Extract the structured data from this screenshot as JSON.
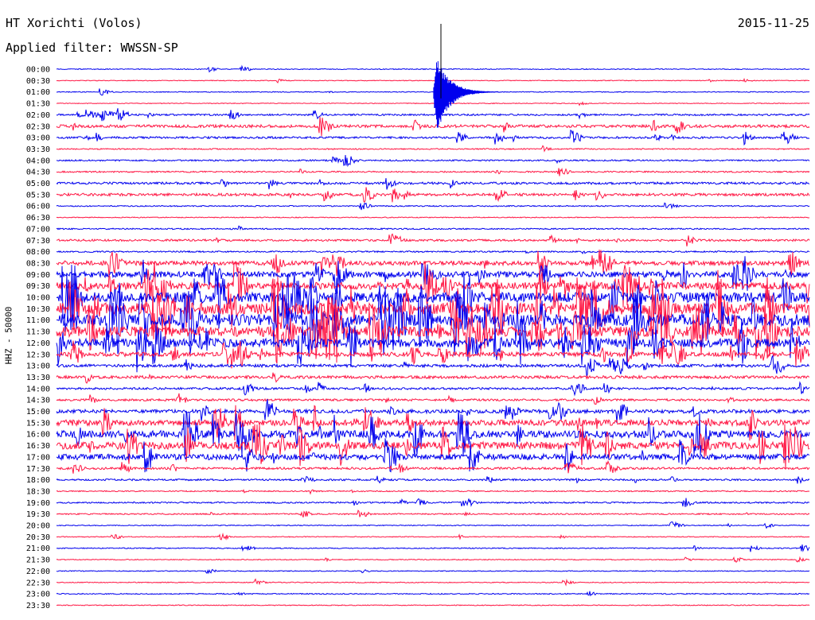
{
  "chart_data": {
    "type": "line",
    "title": "HT Xorichti (Volos)",
    "subtitle": "Applied filter: WWSSN-SP",
    "date": "2015-11-25",
    "ylabel": "HHZ - 50000",
    "row_labels": [
      "00:00",
      "00:30",
      "01:00",
      "01:30",
      "02:00",
      "02:30",
      "03:00",
      "03:30",
      "04:00",
      "04:30",
      "05:00",
      "05:30",
      "06:00",
      "06:30",
      "07:00",
      "07:30",
      "08:00",
      "08:30",
      "09:00",
      "09:30",
      "10:00",
      "10:30",
      "11:00",
      "11:30",
      "12:00",
      "12:30",
      "13:00",
      "13:30",
      "14:00",
      "14:30",
      "15:00",
      "15:30",
      "16:00",
      "16:30",
      "17:00",
      "17:30",
      "18:00",
      "18:30",
      "19:00",
      "19:30",
      "20:00",
      "20:30",
      "21:00",
      "21:30",
      "22:00",
      "22:30",
      "23:00",
      "23:30"
    ],
    "row_activity": [
      0.6,
      0.5,
      0.6,
      0.5,
      1.2,
      2.0,
      1.4,
      0.8,
      1.0,
      1.0,
      1.6,
      1.8,
      0.8,
      0.6,
      0.9,
      1.4,
      1.0,
      3.0,
      4.0,
      5.0,
      7.0,
      8.0,
      8.0,
      7.0,
      6.0,
      3.0,
      2.0,
      2.0,
      1.5,
      1.5,
      2.5,
      4.0,
      5.0,
      5.0,
      4.0,
      1.5,
      1.2,
      0.8,
      1.0,
      0.9,
      0.6,
      0.6,
      0.7,
      0.6,
      0.6,
      0.6,
      0.7,
      0.6
    ],
    "series_colors": [
      "#0000ee",
      "#ff1744"
    ],
    "events": [
      {
        "row": 2,
        "minute": 15,
        "amplitude": 60,
        "label": ""
      }
    ],
    "grid": false
  }
}
